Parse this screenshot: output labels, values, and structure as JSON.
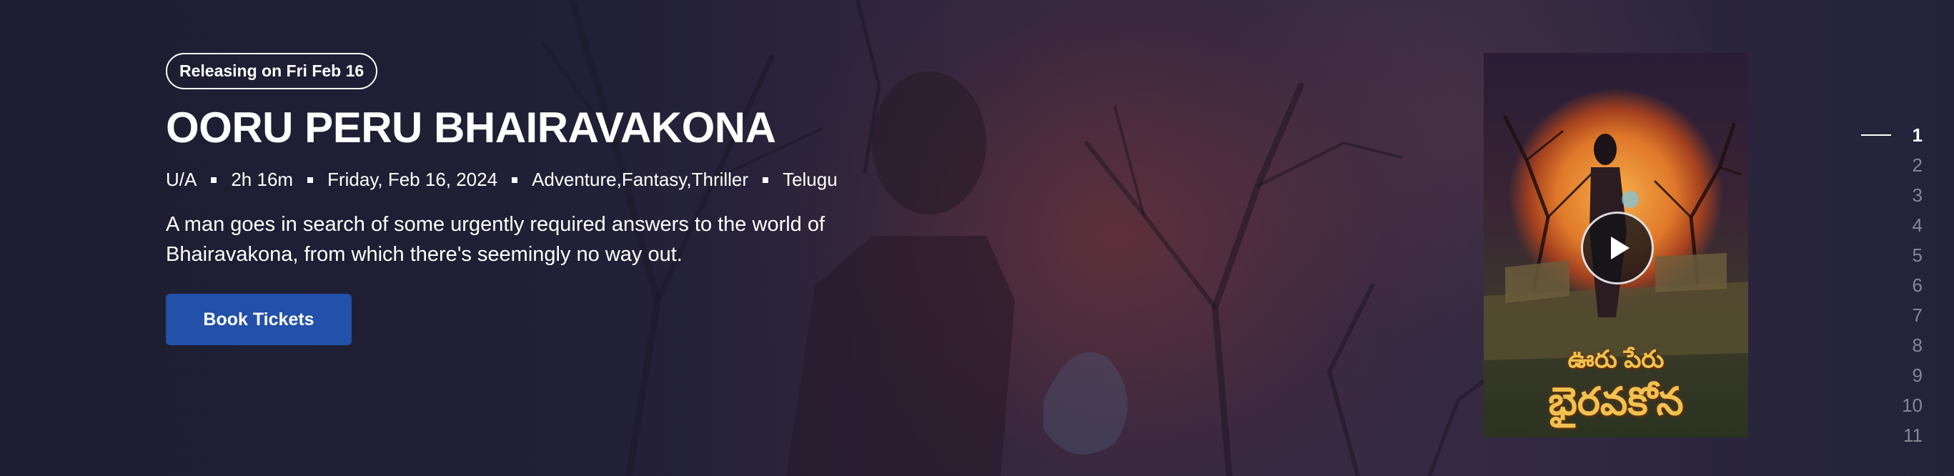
{
  "hero": {
    "badge": "Releasing on Fri Feb 16",
    "title": "OORU PERU BHAIRAVAKONA",
    "meta": {
      "rating": "U/A",
      "duration": "2h 16m",
      "date": "Friday, Feb 16, 2024",
      "genres": "Adventure,Fantasy,Thriller",
      "language": "Telugu"
    },
    "description": "A man goes in search of some urgently required answers to the world of Bhairavakona, from which there's seemingly no way out.",
    "cta_label": "Book Tickets",
    "cta_color": "#2350a8"
  },
  "poster": {
    "title_line1": "ఊరు పేరు",
    "title_line2": "భైరవకోన",
    "play_icon": "play-icon"
  },
  "pagination": {
    "active": "1",
    "pages": [
      "1",
      "2",
      "3",
      "4",
      "5",
      "6",
      "7",
      "8",
      "9",
      "10",
      "11"
    ]
  }
}
